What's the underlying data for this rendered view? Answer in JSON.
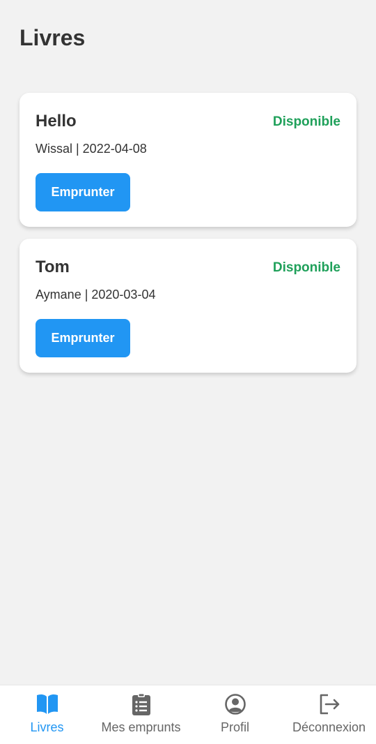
{
  "header": {
    "title": "Livres"
  },
  "colors": {
    "accent": "#2196f3",
    "status_available": "#1fa05a",
    "tab_inactive": "#666666",
    "background": "#f2f2f2"
  },
  "books": [
    {
      "title": "Hello",
      "status": "Disponible",
      "meta": "Wissal | 2022-04-08",
      "action_label": "Emprunter"
    },
    {
      "title": "Tom",
      "status": "Disponible",
      "meta": "Aymane | 2020-03-04",
      "action_label": "Emprunter"
    }
  ],
  "tabs": [
    {
      "label": "Livres",
      "icon": "book-open-icon",
      "active": true
    },
    {
      "label": "Mes emprunts",
      "icon": "clipboard-list-icon",
      "active": false
    },
    {
      "label": "Profil",
      "icon": "user-circle-icon",
      "active": false
    },
    {
      "label": "Déconnexion",
      "icon": "logout-icon",
      "active": false
    }
  ]
}
